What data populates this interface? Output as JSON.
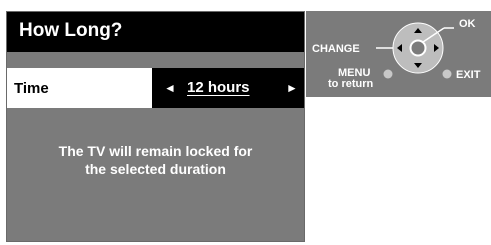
{
  "dialog": {
    "title": "How Long?",
    "setting_label": "Time",
    "setting_value": "12 hours",
    "left_arrow": "◄",
    "right_arrow": "►",
    "message_line1": "The TV will remain locked for",
    "message_line2": "the selected duration"
  },
  "remote_help": {
    "ok_label": "OK",
    "change_label": "CHANGE",
    "menu_label": "MENU",
    "menu_sub_label": "to return",
    "exit_label": "EXIT"
  },
  "colors": {
    "panel_bg": "#7b7b7b",
    "title_bg": "#000000",
    "text": "#ffffff"
  }
}
